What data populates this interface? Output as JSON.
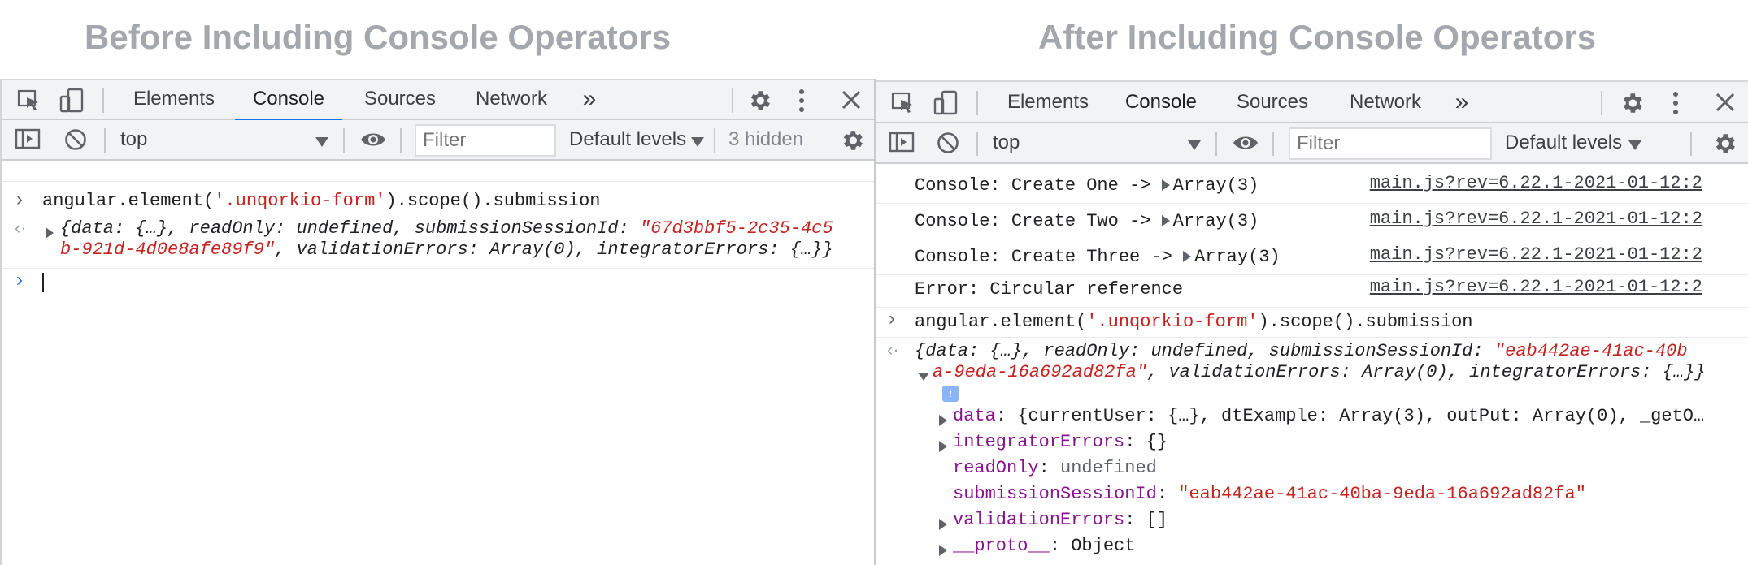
{
  "headings": {
    "left": "Before Including Console Operators",
    "right": "After Including Console Operators"
  },
  "colors": {
    "heading": "#a4a7ac",
    "accent": "#1a73e8",
    "string": "#c5221f",
    "key": "#881391"
  },
  "icons": [
    "inspect-icon",
    "device-toggle-icon",
    "more-tabs-icon",
    "settings-gear-icon",
    "kebab-menu-icon",
    "close-icon",
    "sidebar-toggle-icon",
    "clear-console-icon",
    "eye-icon"
  ],
  "tabs": {
    "elements": "Elements",
    "console": "Console",
    "sources": "Sources",
    "network": "Network",
    "more": "»"
  },
  "toolbar": {
    "context": "top",
    "filter_placeholder": "Filter",
    "levels": "Default levels",
    "hidden_count": "3 hidden"
  },
  "left": {
    "command": {
      "a": "angular.element(",
      "b": "'.unqorkio-form'",
      "c": ").scope().submission"
    },
    "result": {
      "l1a": "{data: {…}, readOnly: undefined, submissionSessionId: ",
      "l1b": "\"67d3bbf5-2c35-4c5",
      "l2a": "b-921d-4d0e8afe89f9\"",
      "l2b": ", validationErrors: Array(0), integratorErrors: {…}}"
    }
  },
  "right": {
    "messages": [
      {
        "label": "Console: Create One -> ",
        "value": "Array(3)",
        "source": "main.js?rev=6.22.1-2021-01-12:2"
      },
      {
        "label": "Console: Create Two -> ",
        "value": "Array(3)",
        "source": "main.js?rev=6.22.1-2021-01-12:2"
      },
      {
        "label": "Console: Create Three -> ",
        "value": "Array(3)",
        "source": "main.js?rev=6.22.1-2021-01-12:2"
      },
      {
        "label": "Error: Circular reference",
        "value": "",
        "source": "main.js?rev=6.22.1-2021-01-12:2"
      }
    ],
    "command": {
      "a": "angular.element(",
      "b": "'.unqorkio-form'",
      "c": ").scope().submission"
    },
    "result": {
      "l1a": "{data: {…}, readOnly: undefined, submissionSessionId: ",
      "l1b": "\"eab442ae-41ac-40b",
      "l2a": "a-9eda-16a692ad82fa\"",
      "l2b": ", validationErrors: Array(0), integratorErrors: {…}}",
      "info": "i"
    },
    "props": [
      {
        "key": "data",
        "value": "{currentUser: {…}, dtExample: Array(3), outPut: Array(0), _getO…",
        "expandable": true
      },
      {
        "key": "integratorErrors",
        "value": "{}",
        "expandable": true
      },
      {
        "key": "readOnly",
        "value": "undefined",
        "expandable": false
      },
      {
        "key": "submissionSessionId",
        "value": "\"eab442ae-41ac-40ba-9eda-16a692ad82fa\"",
        "expandable": false
      },
      {
        "key": "validationErrors",
        "value": "[]",
        "expandable": true
      },
      {
        "key": "__proto__",
        "value": "Object",
        "expandable": true
      }
    ]
  }
}
